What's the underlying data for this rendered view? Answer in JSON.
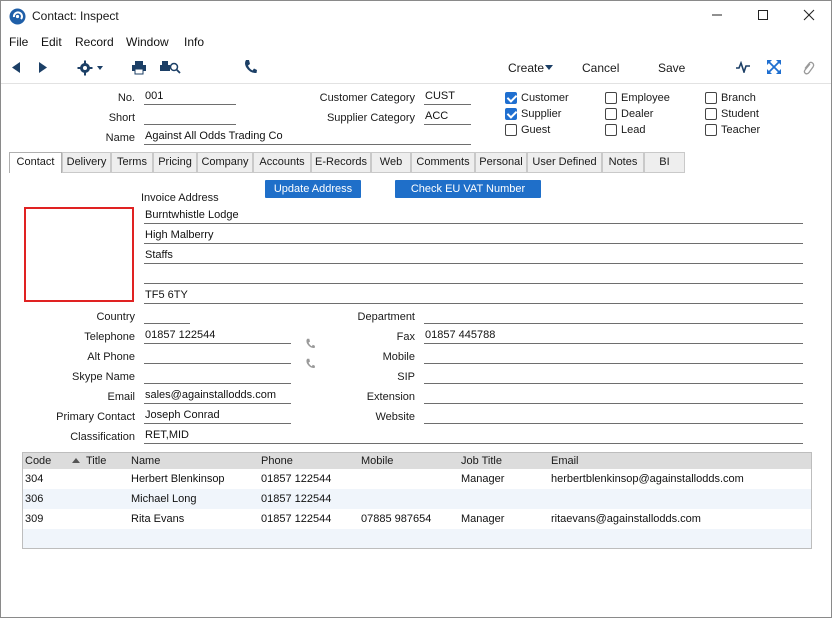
{
  "window": {
    "title": "Contact: Inspect"
  },
  "menu": [
    "File",
    "Edit",
    "Record",
    "Window",
    "Info"
  ],
  "toolbar": {
    "create": "Create",
    "cancel": "Cancel",
    "save": "Save"
  },
  "header": {
    "no_label": "No.",
    "no_value": "001",
    "short_label": "Short",
    "short_value": "",
    "name_label": "Name",
    "name_value": "Against All Odds Trading Co",
    "customer_category_label": "Customer Category",
    "customer_category_value": "CUST",
    "supplier_category_label": "Supplier Category",
    "supplier_category_value": "ACC"
  },
  "checkboxes": [
    {
      "label": "Customer",
      "checked": true
    },
    {
      "label": "Supplier",
      "checked": true
    },
    {
      "label": "Guest",
      "checked": false
    },
    {
      "label": "Employee",
      "checked": false
    },
    {
      "label": "Dealer",
      "checked": false
    },
    {
      "label": "Lead",
      "checked": false
    },
    {
      "label": "Branch",
      "checked": false
    },
    {
      "label": "Student",
      "checked": false
    },
    {
      "label": "Teacher",
      "checked": false
    }
  ],
  "tabs": [
    "Contact",
    "Delivery",
    "Terms",
    "Pricing",
    "Company",
    "Accounts",
    "E-Records",
    "Web",
    "Comments",
    "Personal",
    "User Defined",
    "Notes",
    "BI"
  ],
  "contact": {
    "update_address": "Update Address",
    "check_vat": "Check EU VAT Number",
    "invoice_address_label": "Invoice Address",
    "address_lines": [
      "Burntwhistle Lodge",
      "High Malberry",
      "Staffs",
      "",
      "TF5 6TY"
    ],
    "country_label": "Country",
    "country_value": "",
    "telephone_label": "Telephone",
    "telephone_value": "01857 122544",
    "alt_phone_label": "Alt Phone",
    "alt_phone_value": "",
    "skype_label": "Skype Name",
    "skype_value": "",
    "email_label": "Email",
    "email_value": "sales@againstallodds.com",
    "primary_contact_label": "Primary Contact",
    "primary_contact_value": "Joseph Conrad",
    "classification_label": "Classification",
    "classification_value": "RET,MID",
    "department_label": "Department",
    "department_value": "",
    "fax_label": "Fax",
    "fax_value": "01857 445788",
    "mobile_label": "Mobile",
    "mobile_value": "",
    "sip_label": "SIP",
    "sip_value": "",
    "extension_label": "Extension",
    "extension_value": "",
    "website_label": "Website",
    "website_value": ""
  },
  "grid": {
    "headers": [
      "Code",
      "Title",
      "Name",
      "Phone",
      "Mobile",
      "Job Title",
      "Email"
    ],
    "rows": [
      [
        "304",
        "",
        "Herbert Blenkinsop",
        "01857 122544",
        "",
        "Manager",
        "herbertblenkinsop@againstallodds.com"
      ],
      [
        "306",
        "",
        "Michael Long",
        "01857 122544",
        "",
        "",
        ""
      ],
      [
        "309",
        "",
        "Rita Evans",
        "01857 122544",
        "07885 987654",
        "Manager",
        "ritaevans@againstallodds.com"
      ]
    ]
  },
  "colors": {
    "accent": "#1f6fc9",
    "checkbox_on": "#1f6fd0",
    "highlight_box": "#e02222",
    "grid_header": "#dcdcdc",
    "row_alt": "#f0f5fb"
  }
}
